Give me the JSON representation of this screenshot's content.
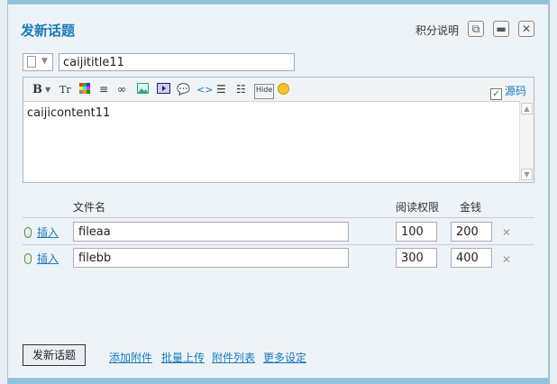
{
  "dialog": {
    "title": "发新话题",
    "score_link": "积分说明",
    "icons": {
      "popout": "popout-icon",
      "maximize": "maximize-icon",
      "close": "close-icon"
    }
  },
  "subject": {
    "value": "caijititle11"
  },
  "editor": {
    "toolbar": {
      "bold": "B",
      "font_size": "Tr",
      "hide": "Hide",
      "source_label": "源码",
      "source_checked": true
    },
    "content": "caijicontent11"
  },
  "attachments": {
    "headers": {
      "filename": "文件名",
      "read_perm": "阅读权限",
      "price": "金钱"
    },
    "rows": [
      {
        "insert_label": "插入",
        "filename": "fileaa",
        "read_perm": "100",
        "price": "200"
      },
      {
        "insert_label": "插入",
        "filename": "filebb",
        "read_perm": "300",
        "price": "400"
      }
    ]
  },
  "footer": {
    "submit_label": "发新话题",
    "links": [
      "添加附件",
      "批量上传",
      "附件列表",
      "更多设定"
    ]
  },
  "colors": {
    "accent": "#1b7ab8",
    "background": "#eef3f7",
    "frame": "#8fc3de"
  }
}
